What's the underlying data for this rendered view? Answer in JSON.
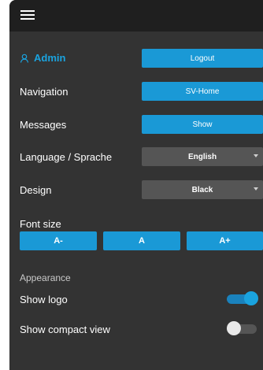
{
  "header": {
    "menu_icon": "hamburger-icon"
  },
  "user": {
    "icon": "user-icon",
    "name": "Admin",
    "logout_label": "Logout"
  },
  "navigation": {
    "label": "Navigation",
    "value": "SV-Home"
  },
  "messages": {
    "label": "Messages",
    "value": "Show"
  },
  "language": {
    "label": "Language / Sprache",
    "value": "English"
  },
  "design": {
    "label": "Design",
    "value": "Black"
  },
  "font_size": {
    "label": "Font size",
    "buttons": [
      "A-",
      "A",
      "A+"
    ]
  },
  "appearance": {
    "title": "Appearance",
    "show_logo": {
      "label": "Show logo",
      "on": true
    },
    "compact_view": {
      "label": "Show compact view",
      "on": false
    }
  },
  "colors": {
    "accent": "#1a99d6",
    "panel": "#333333",
    "topbar": "#1f1f1f",
    "select": "#555555"
  }
}
